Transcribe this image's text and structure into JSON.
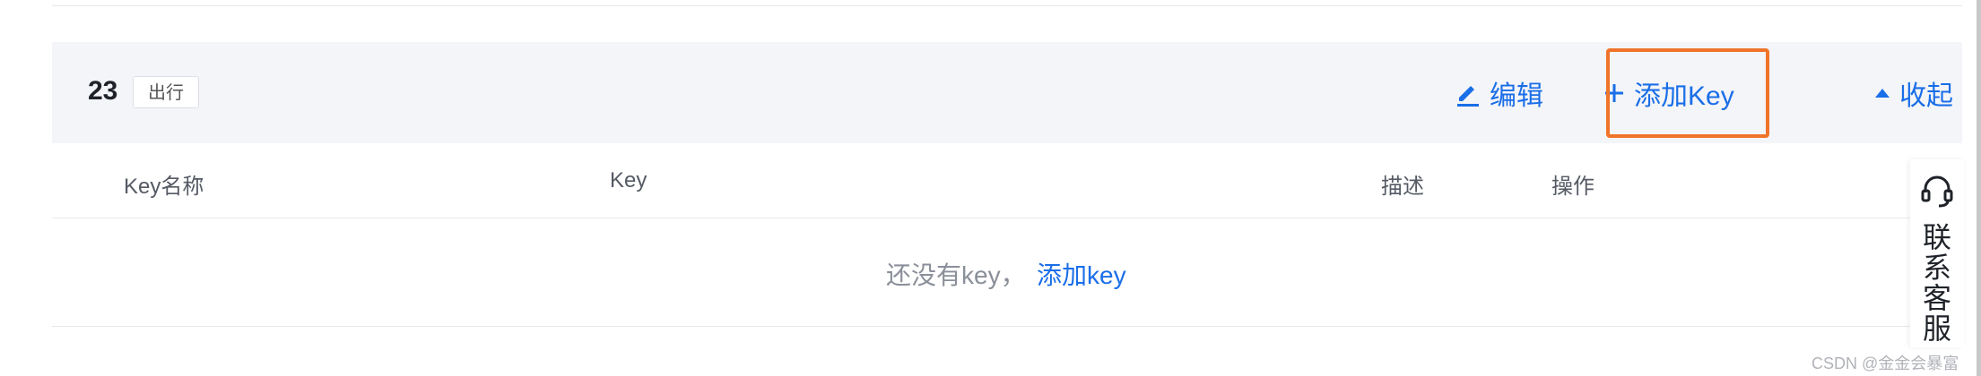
{
  "app": {
    "name": "23",
    "badge": "出行"
  },
  "actions": {
    "edit": "编辑",
    "add_key": "添加Key",
    "collapse": "收起"
  },
  "table": {
    "columns": [
      "Key名称",
      "Key",
      "描述",
      "操作"
    ],
    "empty_text": "还没有key，",
    "empty_link": "添加key"
  },
  "service": {
    "label": "联系客服",
    "icon": "headset-icon"
  },
  "watermark": "CSDN @金金会暴富",
  "colors": {
    "link": "#1a6ee8",
    "highlight": "#f0742a",
    "header_bg": "#f4f5f8"
  }
}
